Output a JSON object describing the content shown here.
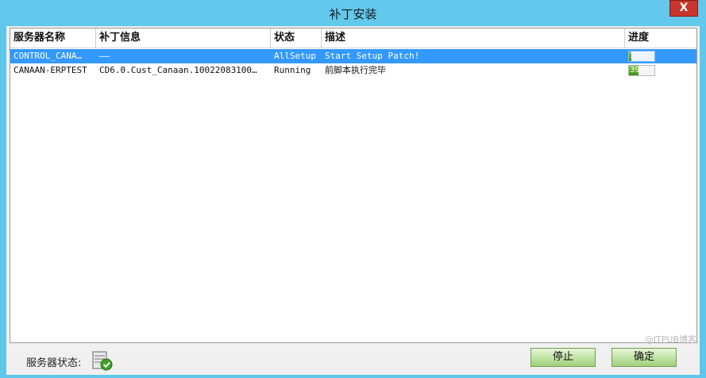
{
  "window": {
    "title": "补丁安装",
    "close_label": "X"
  },
  "grid": {
    "columns": [
      "服务器名称",
      "补丁信息",
      "状态",
      "描述",
      "进度"
    ],
    "rows": [
      {
        "server": "CONTROL_CANA…",
        "patch": "——",
        "status": "AllSetup",
        "description": "Start Setup Patch!",
        "progress_label": "10%",
        "progress": 0.1,
        "selected": true
      },
      {
        "server": "CANAAN-ERPTEST",
        "patch": "CD6.0.Cust_Canaan.10022083100…",
        "status": "Running",
        "description": "前脚本执行完毕",
        "progress_label": "39%",
        "progress": 0.39,
        "selected": false
      }
    ]
  },
  "footer": {
    "server_status_label": "服务器状态:",
    "server_status_icon": "server-ok-icon",
    "stop_label": "停止",
    "ok_label": "确定",
    "watermark": "@ITPUB博客"
  },
  "colors": {
    "titlebar": "#62c9ec",
    "selection": "#3399ff",
    "close": "#c8352c",
    "progress": "#5aa92a"
  }
}
